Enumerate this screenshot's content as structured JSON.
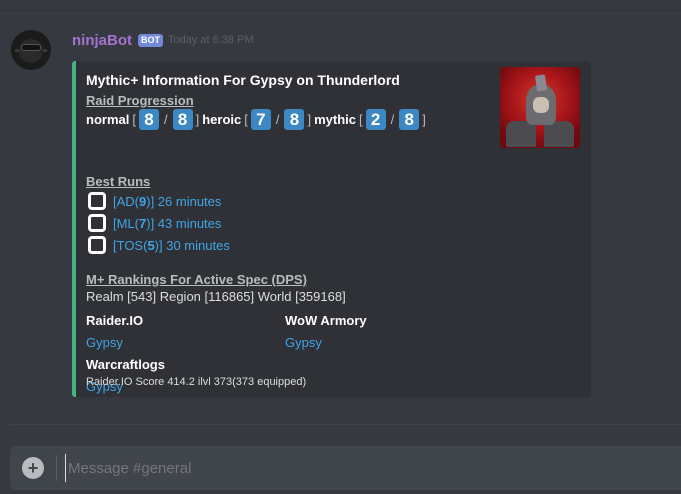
{
  "message": {
    "username": "ninjaBot",
    "bot_tag": "BOT",
    "timestamp": "Today at 6:38 PM",
    "avatar_icon": "ninja-mask-icon"
  },
  "embed": {
    "accent_color": "#43b581",
    "title": "Mythic+ Information For Gypsy on Thunderlord",
    "thumbnail_icon": "character-portrait",
    "raid_progression": {
      "label": "Raid Progression",
      "normal_label": "normal",
      "normal_done": "8",
      "normal_total": "8",
      "heroic_label": "heroic",
      "heroic_done": "7",
      "heroic_total": "8",
      "mythic_label": "mythic",
      "mythic_done": "2",
      "mythic_total": "8",
      "open_bracket": "[",
      "close_bracket": "]",
      "slash": "/"
    },
    "best_runs": {
      "label": "Best Runs",
      "runs": [
        {
          "open": "[AD(",
          "level": "9",
          "close": ")]",
          "time": " 26 minutes"
        },
        {
          "open": "[ML(",
          "level": "7",
          "close": ")]",
          "time": " 43 minutes"
        },
        {
          "open": "[TOS(",
          "level": "5",
          "close": ")]",
          "time": " 30 minutes"
        }
      ]
    },
    "rankings": {
      "label": "M+ Rankings For Active Spec (DPS)",
      "text": "Realm [543] Region [116865] World [359168]"
    },
    "links": {
      "raiderio_title": "Raider.IO",
      "raiderio_link": "Gypsy",
      "armory_title": "WoW Armory",
      "armory_link": "Gypsy",
      "warcraftlogs_title": "Warcraftlogs",
      "warcraftlogs_link": "Gypsy"
    },
    "footer": "Raider.IO Score 414.2 ilvl 373(373 equipped)"
  },
  "composer": {
    "placeholder": "Message #general",
    "attach_icon": "plus-circle-icon"
  }
}
